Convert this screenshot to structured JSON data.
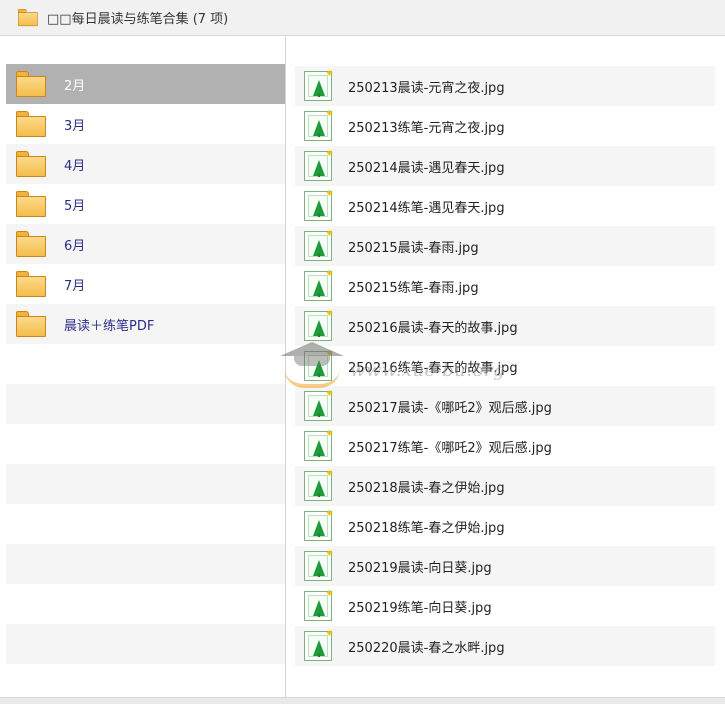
{
  "window": {
    "title": "□□每日晨读与练笔合集 (7 项)"
  },
  "icons": {
    "folder": "folder-icon",
    "image_file": "image-file-icon"
  },
  "colors": {
    "selected_row": "#b1b1b1",
    "folder_label": "#2d2d8c",
    "folder_fill": "#f4bd4c"
  },
  "left_pane": {
    "folders": [
      {
        "label": "2月"
      },
      {
        "label": "3月"
      },
      {
        "label": "4月"
      },
      {
        "label": "5月"
      },
      {
        "label": "6月"
      },
      {
        "label": "7月"
      },
      {
        "label": "晨读＋练笔PDF"
      }
    ]
  },
  "right_pane": {
    "files": [
      {
        "name": "250213晨读-元宵之夜.jpg"
      },
      {
        "name": "250213练笔-元宵之夜.jpg"
      },
      {
        "name": "250214晨读-遇见春天.jpg"
      },
      {
        "name": "250214练笔-遇见春天.jpg"
      },
      {
        "name": "250215晨读-春雨.jpg"
      },
      {
        "name": "250215练笔-春雨.jpg"
      },
      {
        "name": "250216晨读-春天的故事.jpg"
      },
      {
        "name": "250216练笔-春天的故事.jpg"
      },
      {
        "name": "250217晨读-《哪吒2》观后感.jpg"
      },
      {
        "name": "250217练笔-《哪吒2》观后感.jpg"
      },
      {
        "name": "250218晨读-春之伊始.jpg"
      },
      {
        "name": "250218练笔-春之伊始.jpg"
      },
      {
        "name": "250219晨读-向日葵.jpg"
      },
      {
        "name": "250219练笔-向日葵.jpg"
      },
      {
        "name": "250220晨读-春之水畔.jpg"
      }
    ]
  },
  "watermark": {
    "text": "www.xue-bu.org"
  }
}
